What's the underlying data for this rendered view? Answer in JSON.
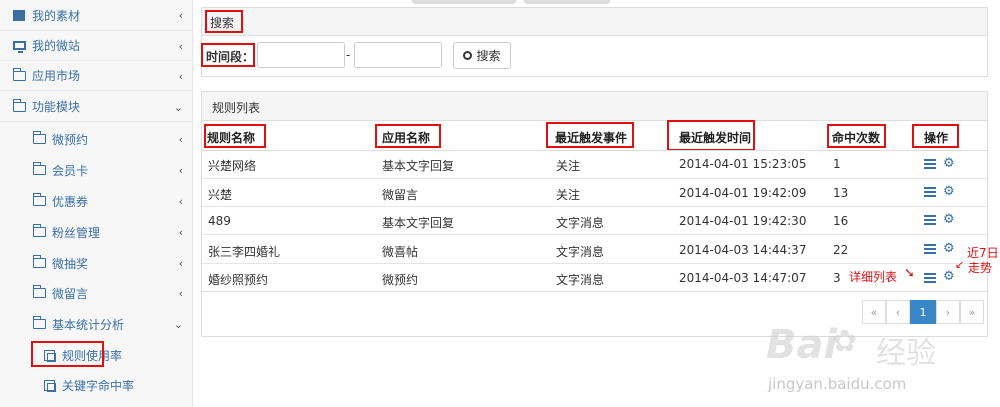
{
  "sidebar": {
    "items": [
      {
        "label": "我的素材",
        "icon": "box-icon"
      },
      {
        "label": "我的微站",
        "icon": "monitor-icon"
      },
      {
        "label": "应用市场",
        "icon": "folder-icon"
      },
      {
        "label": "功能模块",
        "icon": "folder-icon"
      },
      {
        "label": "微预约",
        "icon": "folder-icon"
      },
      {
        "label": "会员卡",
        "icon": "folder-icon"
      },
      {
        "label": "优惠券",
        "icon": "folder-icon"
      },
      {
        "label": "粉丝管理",
        "icon": "folder-icon"
      },
      {
        "label": "微抽奖",
        "icon": "folder-icon"
      },
      {
        "label": "微留言",
        "icon": "folder-icon"
      },
      {
        "label": "基本统计分析",
        "icon": "folder-icon"
      },
      {
        "label": "规则使用率",
        "icon": "sheet-icon"
      },
      {
        "label": "关键字命中率",
        "icon": "sheet-icon"
      }
    ]
  },
  "search": {
    "title": "搜索",
    "period_label": "时间段：",
    "range_separator": "-",
    "button_label": "搜索"
  },
  "rules": {
    "title": "规则列表",
    "columns": [
      "规则名称",
      "应用名称",
      "最近触发事件",
      "最近触发时间",
      "命中次数",
      "操作"
    ],
    "rows": [
      {
        "name": "兴楚网络",
        "app": "基本文字回复",
        "event": "关注",
        "time": "2014-04-01 15:23:05",
        "hits": "1"
      },
      {
        "name": "兴楚",
        "app": "微留言",
        "event": "关注",
        "time": "2014-04-01 19:42:09",
        "hits": "13"
      },
      {
        "name": "489",
        "app": "基本文字回复",
        "event": "文字消息",
        "time": "2014-04-01 19:42:30",
        "hits": "16"
      },
      {
        "name": "张三李四婚礼",
        "app": "微喜帖",
        "event": "文字消息",
        "time": "2014-04-03 14:44:37",
        "hits": "22"
      },
      {
        "name": "婚纱照预约",
        "app": "微预约",
        "event": "文字消息",
        "time": "2014-04-03 14:47:07",
        "hits": "3"
      }
    ],
    "annotations": {
      "detail": "详细列表",
      "trend_line1": "近7日",
      "trend_line2": "走势"
    }
  },
  "pagination": {
    "first": "«",
    "prev": "‹",
    "current": "1",
    "next": "›",
    "last": "»"
  },
  "watermark": {
    "brand": "Bai",
    "brand_cn": "经验",
    "url": "jingyan.baidu.com"
  },
  "colors": {
    "accent": "#3a6fa6",
    "highlight": "#e01010",
    "active_page": "#3a87c8"
  }
}
